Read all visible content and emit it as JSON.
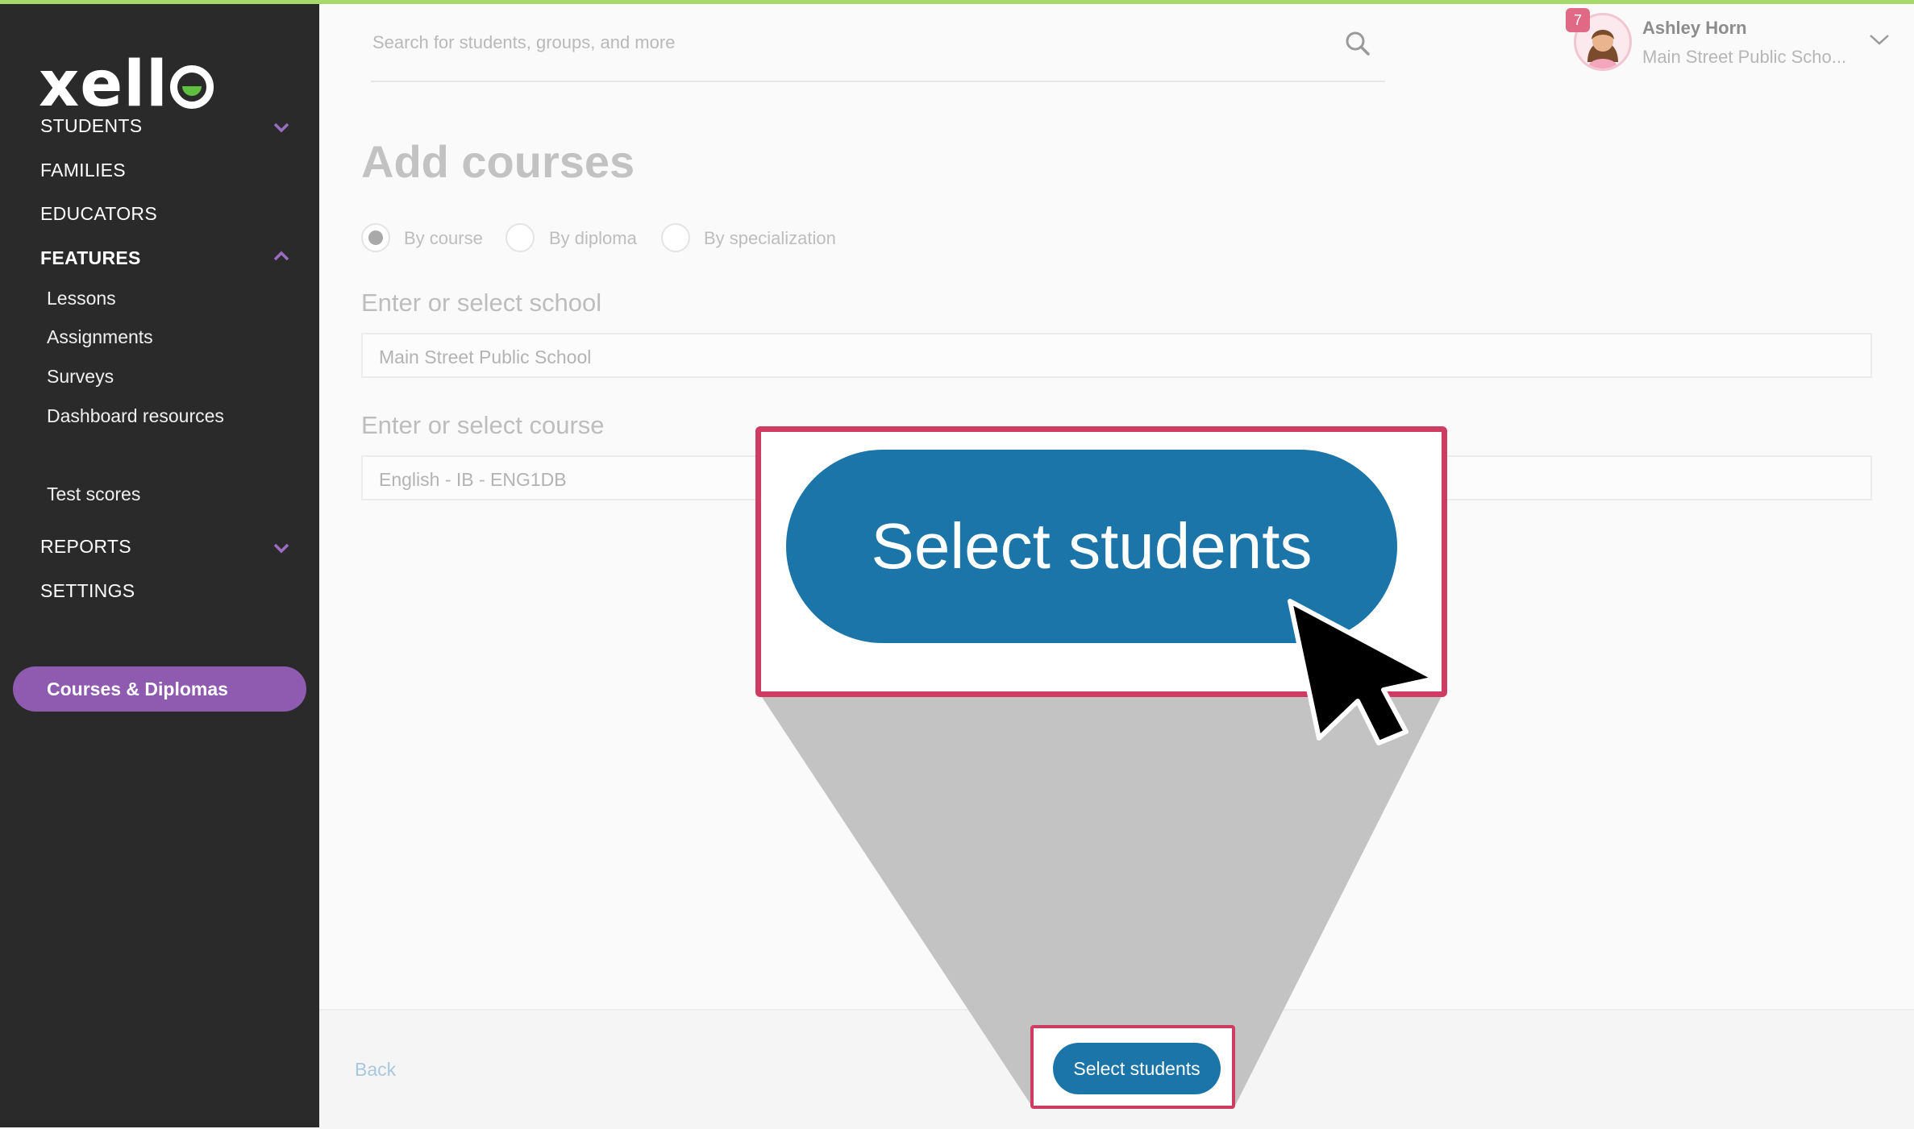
{
  "sidebar": {
    "logo": "xell",
    "nav": [
      {
        "label": "STUDENTS"
      },
      {
        "label": "FAMILIES"
      },
      {
        "label": "EDUCATORS"
      },
      {
        "label": "FEATURES"
      },
      {
        "label": "REPORTS"
      },
      {
        "label": "SETTINGS"
      }
    ],
    "features": [
      {
        "label": "Lessons"
      },
      {
        "label": "Assignments"
      },
      {
        "label": "Surveys"
      },
      {
        "label": "Dashboard resources"
      },
      {
        "label": "Courses & Diplomas"
      },
      {
        "label": "Test scores"
      }
    ]
  },
  "header": {
    "search_placeholder": "Search for students, groups, and more",
    "user": {
      "name": "Ashley Horn",
      "school": "Main Street Public Scho...",
      "notification_count": "7"
    }
  },
  "main": {
    "title": "Add courses",
    "radios": [
      {
        "label": "By course",
        "selected": true
      },
      {
        "label": "By diploma",
        "selected": false
      },
      {
        "label": "By specialization",
        "selected": false
      }
    ],
    "school_label": "Enter or select school",
    "school_value": "Main Street Public School",
    "course_label": "Enter or select course",
    "course_value": "English - IB - ENG1DB"
  },
  "footer": {
    "back_label": "Back",
    "select_students_label": "Select students"
  },
  "callout": {
    "button_label": "Select students"
  },
  "colors": {
    "sidebar_bg": "#2a2a2a",
    "active_nav": "#8e5bb1",
    "button_blue": "#1b75a8",
    "highlight_red": "#cf3c63",
    "top_accent": "#a6d96a"
  }
}
